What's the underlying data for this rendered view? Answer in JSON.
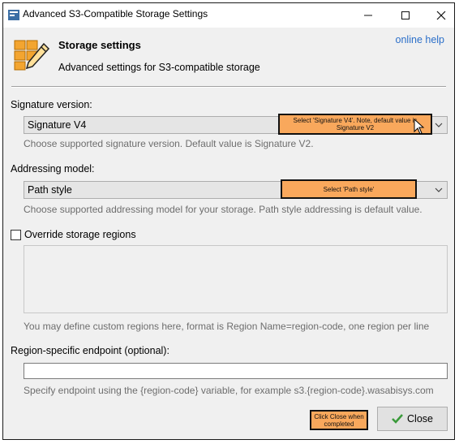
{
  "window": {
    "title": "Advanced S3-Compatible Storage Settings",
    "minimize_icon": "minimize-icon",
    "maximize_icon": "maximize-icon",
    "close_icon": "close-icon"
  },
  "header": {
    "title": "Storage settings",
    "subtitle": "Advanced settings for S3-compatible storage",
    "online_help": "online help",
    "icon": "storage-pencil-icon"
  },
  "signature": {
    "label": "Signature version:",
    "value": "Signature V4",
    "hint": "Choose supported signature version. Default value is Signature V2.",
    "callout": "Select 'Signature V4'. Note, default value is Signature V2"
  },
  "addressing": {
    "label": "Addressing model:",
    "value": "Path style",
    "hint": "Choose supported addressing model for your storage. Path style addressing is default value.",
    "callout": "Select 'Path style'"
  },
  "regions": {
    "checkbox_label": "Override storage regions",
    "checked": false,
    "hint": "You may define custom regions here, format is Region Name=region-code, one region per line"
  },
  "endpoint": {
    "label": "Region-specific endpoint (optional):",
    "value": "",
    "hint": "Specify endpoint using the {region-code} variable, for example s3.{region-code}.wasabisys.com"
  },
  "footer": {
    "close_label": "Close",
    "callout": "Click Close when completed"
  },
  "colors": {
    "callout_fill": "#f9a85c",
    "link": "#2b6fc9",
    "hint_text": "#6d6d6d"
  }
}
